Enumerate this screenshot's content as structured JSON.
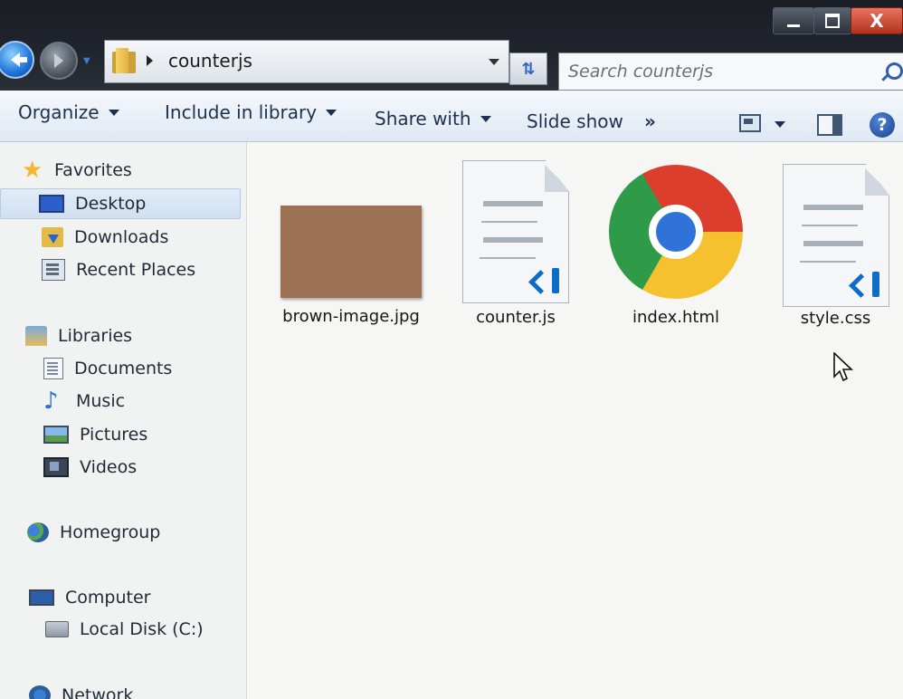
{
  "window": {
    "controls": {
      "minimize": "",
      "maximize": "",
      "close": "X"
    }
  },
  "address_bar": {
    "path": "counterjs"
  },
  "search": {
    "placeholder": "Search counterjs"
  },
  "toolbar": {
    "organize": "Organize",
    "include_in_library": "Include in library",
    "share_with": "Share with",
    "slide_show": "Slide show",
    "more": "»",
    "help": "?"
  },
  "sidebar": {
    "favorites": {
      "label": "Favorites",
      "items": [
        {
          "label": "Desktop",
          "icon": "desktop-icon",
          "selected": true
        },
        {
          "label": "Downloads",
          "icon": "downloads-folder-icon"
        },
        {
          "label": "Recent Places",
          "icon": "recent-places-icon"
        }
      ]
    },
    "libraries": {
      "label": "Libraries",
      "items": [
        {
          "label": "Documents",
          "icon": "document-icon"
        },
        {
          "label": "Music",
          "icon": "music-note-icon"
        },
        {
          "label": "Pictures",
          "icon": "pictures-icon"
        },
        {
          "label": "Videos",
          "icon": "film-icon"
        }
      ]
    },
    "homegroup": {
      "label": "Homegroup"
    },
    "computer": {
      "label": "Computer",
      "items": [
        {
          "label": "Local Disk (C:)",
          "icon": "hard-disk-icon"
        }
      ]
    },
    "network": {
      "label": "Network"
    }
  },
  "files": [
    {
      "name": "brown-image.jpg",
      "icon": "image-thumbnail",
      "thumbnail_color": "#9b7053"
    },
    {
      "name": "counter.js",
      "icon": "vscode-file-icon"
    },
    {
      "name": "index.html",
      "icon": "chrome-logo-icon"
    },
    {
      "name": "style.css",
      "icon": "vscode-file-icon"
    }
  ],
  "colors": {
    "selection": "#d0e0f2",
    "accent": "#2566d0",
    "close_button": "#c8422b"
  }
}
